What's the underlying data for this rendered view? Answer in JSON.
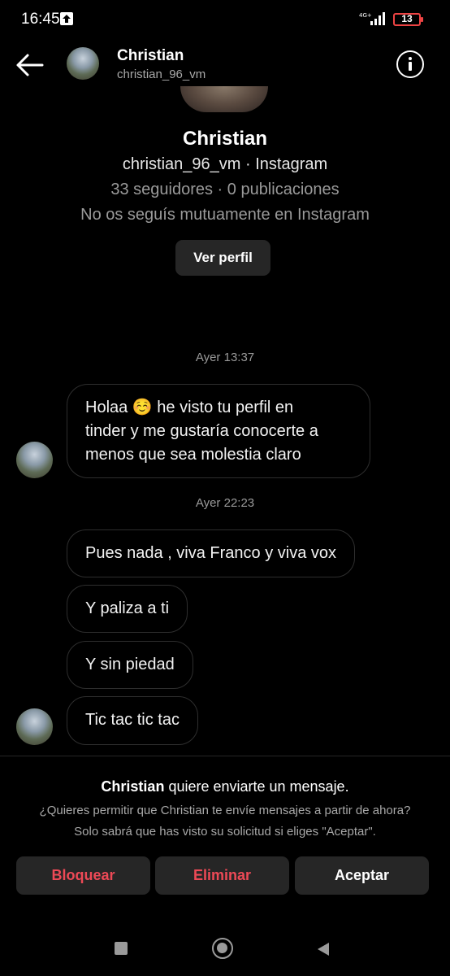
{
  "status_bar": {
    "time": "16:45",
    "network": "4G+",
    "battery": "13"
  },
  "header": {
    "name": "Christian",
    "username": "christian_96_vm"
  },
  "profile": {
    "name": "Christian",
    "handle": "christian_96_vm · Instagram",
    "stats": "33 seguidores · 0 publicaciones",
    "mutual": "No os seguís mutuamente en Instagram",
    "view_profile_label": "Ver perfil"
  },
  "messages": {
    "timestamp_1": "Ayer 13:37",
    "msg_1_lines": [
      "Holaa ☺️ he visto tu perfil en",
      "tinder y me gustaría conocerte a",
      "menos que sea molestia claro"
    ],
    "timestamp_2": "Ayer 22:23",
    "msg_2": "Pues nada , viva Franco y viva vox",
    "msg_3": "Y paliza a ti",
    "msg_4": "Y sin piedad",
    "msg_5": "Tic tac tic tac"
  },
  "request": {
    "title_name": "Christian",
    "title_rest": " quiere enviarte un mensaje.",
    "line_1": "¿Quieres permitir que Christian te envíe mensajes a partir de ahora?",
    "line_2": "Solo sabrá que has visto su solicitud si eliges \"Aceptar\".",
    "block_label": "Bloquear",
    "delete_label": "Eliminar",
    "accept_label": "Aceptar"
  },
  "colors": {
    "background": "#000000",
    "bubble_border": "#2e2e2e",
    "button_bg": "#262626",
    "danger": "#ed4956",
    "battery_low": "#ee4444"
  },
  "icons": [
    "upload-icon",
    "signal-icon",
    "battery-icon",
    "back-arrow-icon",
    "info-icon",
    "nav-recents-icon",
    "nav-home-icon",
    "nav-back-icon"
  ]
}
